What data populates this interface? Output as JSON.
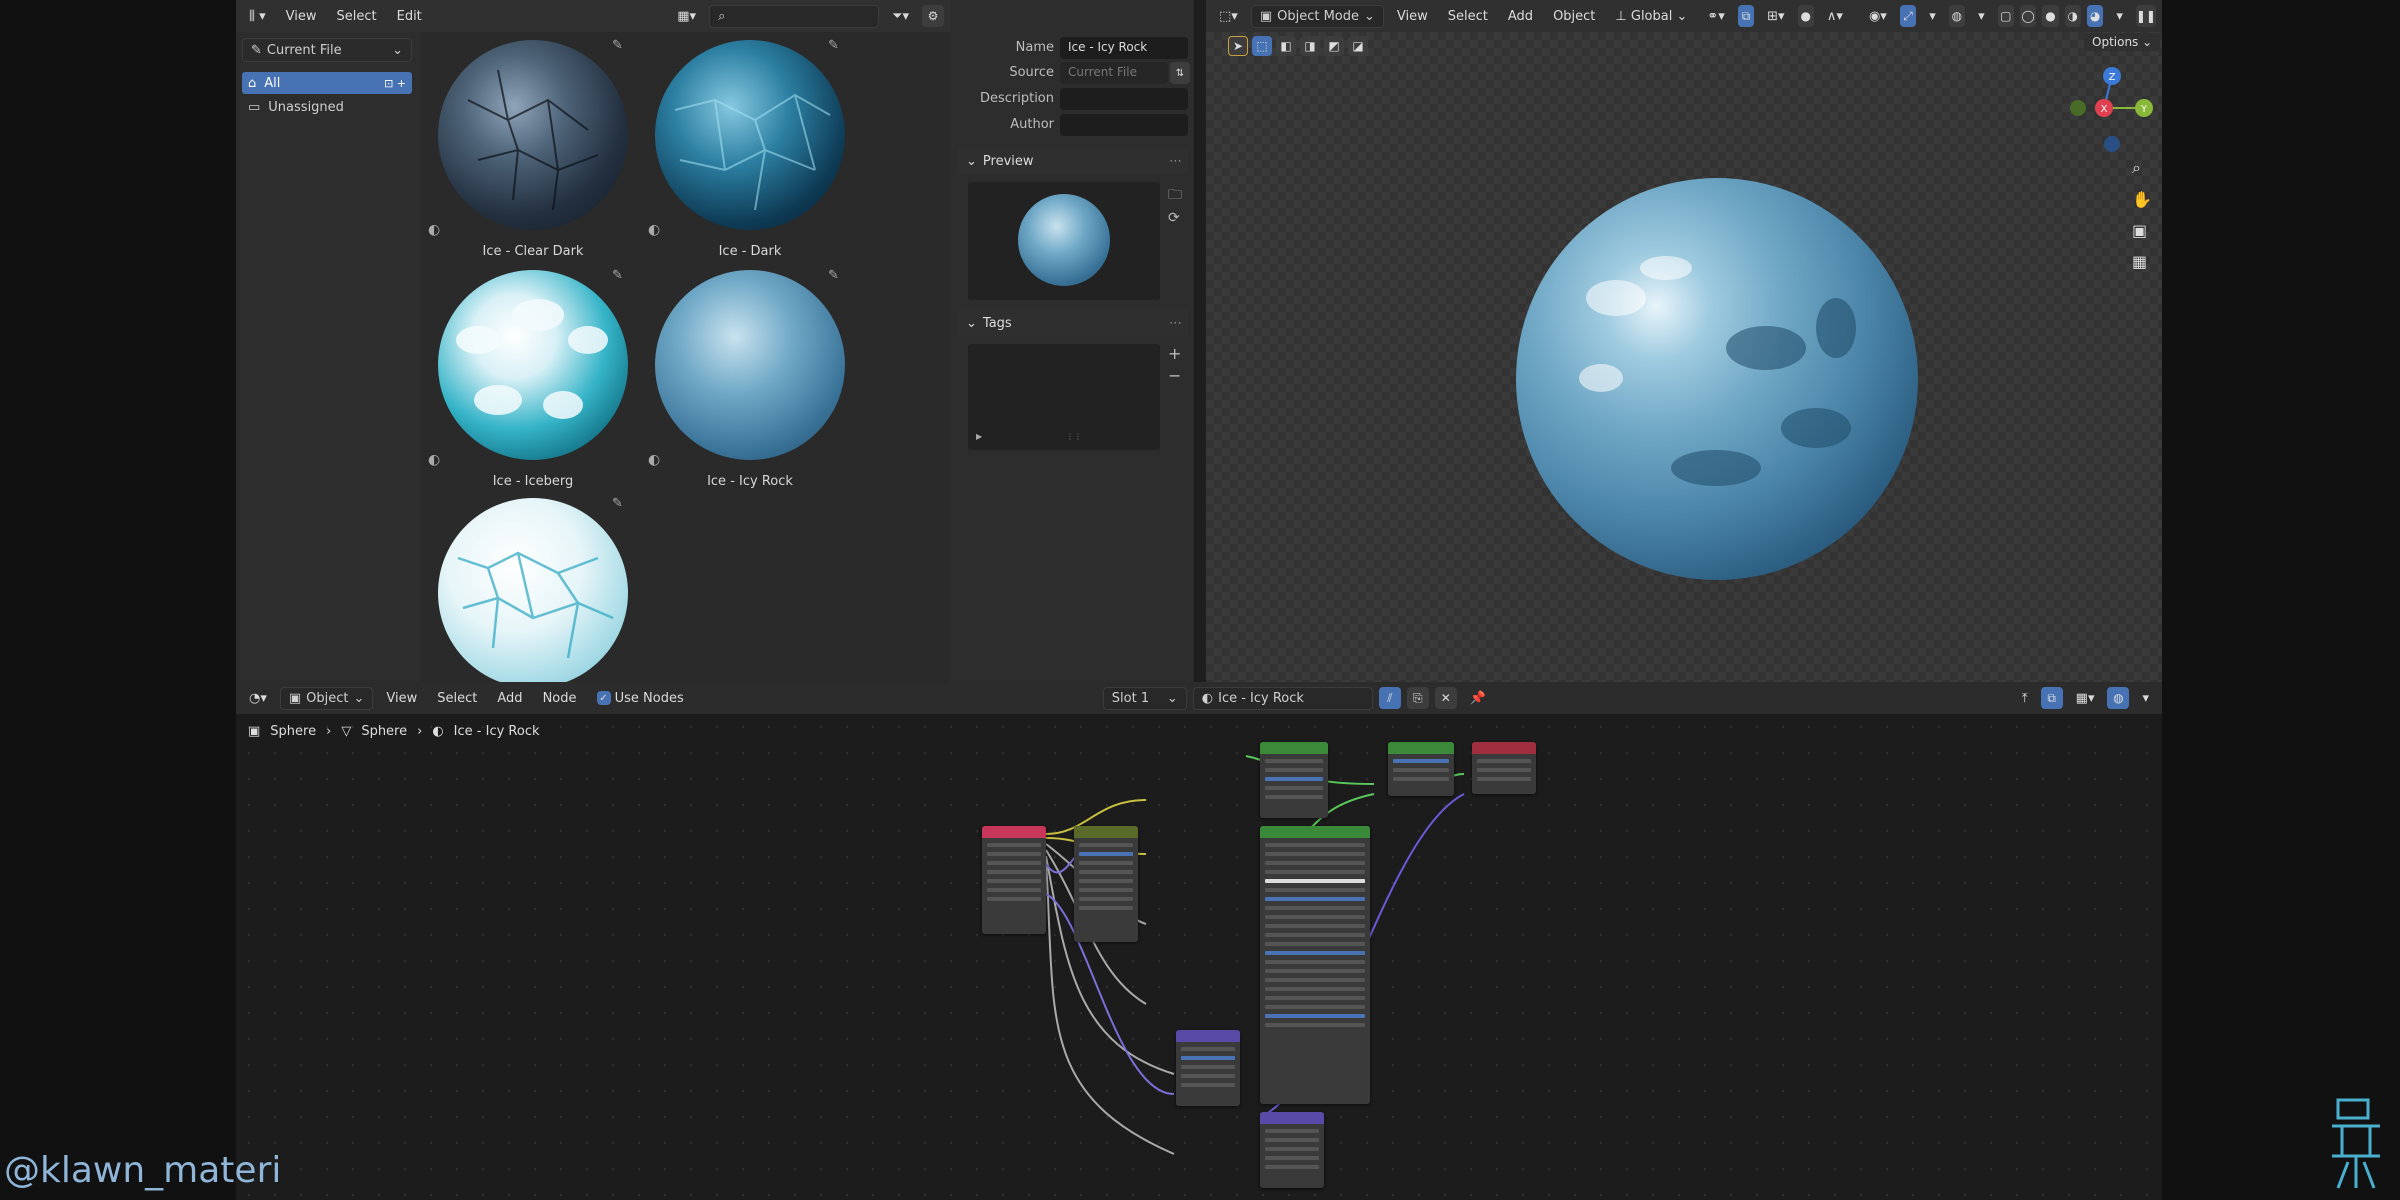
{
  "asset_browser": {
    "menu": [
      "View",
      "Select",
      "Edit"
    ],
    "library": "Current File",
    "catalogs": [
      {
        "label": "All",
        "selected": true
      },
      {
        "label": "Unassigned",
        "selected": false
      }
    ],
    "assets": [
      {
        "name": "Ice - Clear Dark"
      },
      {
        "name": "Ice - Dark"
      },
      {
        "name": "Ice - Iceberg"
      },
      {
        "name": "Ice - Icy Rock"
      },
      {
        "name": ""
      }
    ]
  },
  "properties": {
    "name_label": "Name",
    "name_value": "Ice - Icy Rock",
    "source_label": "Source",
    "source_value": "Current File",
    "description_label": "Description",
    "description_value": "",
    "author_label": "Author",
    "author_value": "",
    "preview_label": "Preview",
    "tags_label": "Tags"
  },
  "viewport": {
    "mode": "Object Mode",
    "menu": [
      "View",
      "Select",
      "Add",
      "Object"
    ],
    "orientation": "Global",
    "options_label": "Options",
    "gizmo": {
      "x": "X",
      "y": "Y",
      "z": "Z"
    }
  },
  "node_editor": {
    "mode": "Object",
    "menu": [
      "View",
      "Select",
      "Add",
      "Node"
    ],
    "use_nodes_label": "Use Nodes",
    "slot": "Slot 1",
    "material": "Ice - Icy Rock",
    "breadcrumb": [
      "Sphere",
      "Sphere",
      "Ice - Icy Rock"
    ]
  },
  "watermark": "@klawn_materi",
  "colors": {
    "accent": "#4772b3",
    "header": "#303030",
    "panel": "#2b2b2b"
  }
}
